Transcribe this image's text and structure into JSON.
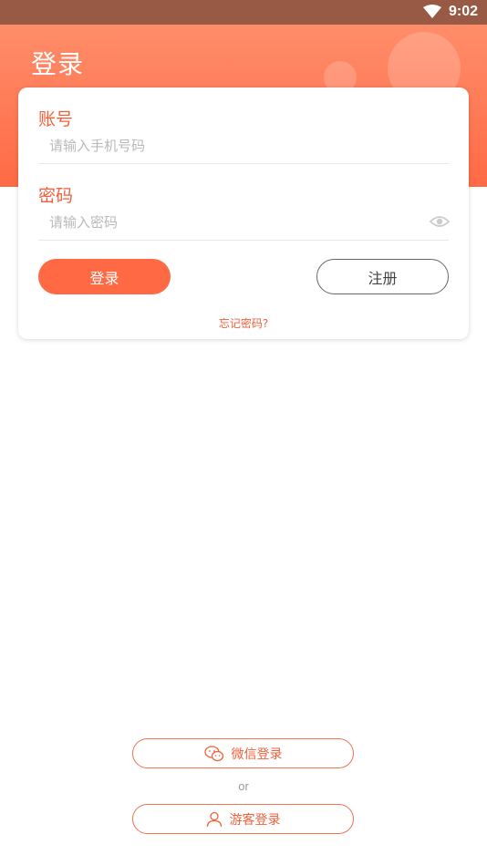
{
  "status_bar": {
    "time": "9:02",
    "icons": [
      "wifi-icon"
    ]
  },
  "header": {
    "title": "登录"
  },
  "form": {
    "account": {
      "label": "账号",
      "placeholder": "请输入手机号码",
      "value": ""
    },
    "password": {
      "label": "密码",
      "placeholder": "请输入密码",
      "value": "",
      "toggle_icon": "eye-icon"
    },
    "login_label": "登录",
    "register_label": "注册",
    "forgot_label": "忘记密码?"
  },
  "alt_login": {
    "wechat_label": "微信登录",
    "wechat_icon": "wechat-icon",
    "or_text": "or",
    "guest_label": "游客登录",
    "guest_icon": "user-icon"
  },
  "colors": {
    "accent": "#ff6a45",
    "accent_text": "#f25f3b",
    "status_bar": "#985a45"
  }
}
